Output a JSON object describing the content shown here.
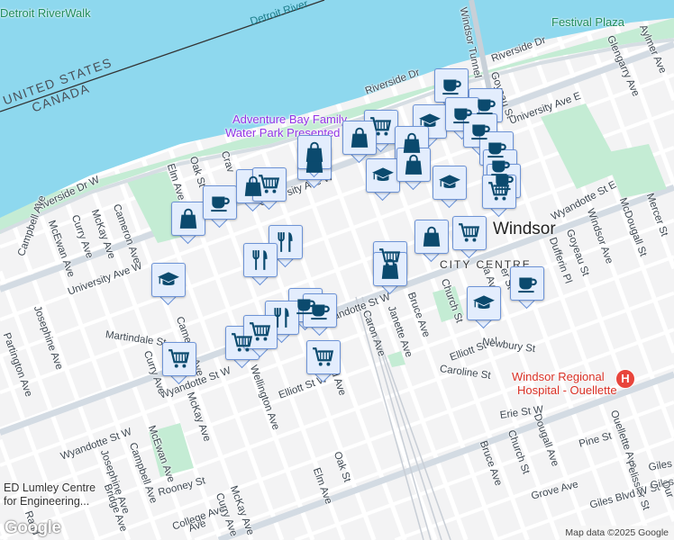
{
  "map": {
    "colors": {
      "water": "#8ed8ee",
      "land": "#f3f3f4",
      "park": "#c4ecd4",
      "marker_fill": "#e3edfd",
      "marker_border": "#6d93d6",
      "icon": "#0b4a6e",
      "hospital": "#e8453c"
    },
    "labels": [
      "Detroit RiverWalk",
      "Detroit River",
      "UNITED STATES",
      "CANADA",
      "Adventure Bay Family",
      "Water Park Presented",
      "Festival Plaza",
      "Windsor Tunnel",
      "Riverside Dr",
      "Riverside Dr",
      "Riverside Dr W",
      "Glengarry Ave",
      "Aylmer Ave",
      "Goyeau St",
      "University Ave E",
      "Oak St",
      "Elm Ave",
      "Crav",
      "University Ave W",
      "University Ave W",
      "Campbell Ave",
      "McEwan Ave",
      "Curry Ave",
      "McKay Ave",
      "Cameron Ave",
      "Windsor",
      "CITY CENTRE",
      "Wyandotte St E",
      "Mercer St",
      "McDougall St",
      "Windsor Ave",
      "Goyeau St",
      "Dufferin Pl",
      "Wyandotte St W",
      "Wyandotte St W",
      "Wyandotte St W",
      "Josephine Ave",
      "Partington Ave",
      "Martindale St",
      "Cameron Ave",
      "Curry Ave",
      "McKay Ave",
      "Wellington Ave",
      "Elliott St W",
      "d Ave",
      "Caron Ave",
      "Janette Ave",
      "Bruce Ave",
      "Church St",
      "Elliott St W",
      "Newbury St",
      "Caroline St",
      "Windsor Regional",
      "Hospital - Ouellette",
      "Erie St W",
      "Dougall Ave",
      "Church St",
      "Bruce Ave",
      "Pine St",
      "Ouellette Ave",
      "Pelissier St",
      "Giles",
      "Grove Ave",
      "Giles Blvd W St",
      "ED Lumley Centre",
      "for Engineering...",
      "Campbell Ave",
      "McEwan Ave",
      "Josephine Ave",
      "Rooney St",
      "Bridge Ave",
      "College Ave",
      "McKay Ave",
      "Curry Ave",
      "Elm Ave",
      "Oak St",
      "Rand",
      "Ave",
      "Giles",
      "Dur",
      "ia Ave",
      "er St"
    ],
    "markers": [
      "coffee",
      "coffee",
      "cart",
      "hat",
      "coffee",
      "coffee",
      "bag",
      "bag",
      "bag",
      "hat",
      "bag",
      "coffee",
      "coffee",
      "coffee",
      "hat",
      "cart",
      "bag",
      "coffee",
      "bag",
      "cart",
      "bag",
      "fork",
      "fork",
      "bag",
      "cart",
      "cart",
      "bag",
      "coffee",
      "hat",
      "hat",
      "cart",
      "cart",
      "cart",
      "coffee",
      "fork",
      "cart",
      "coffee"
    ],
    "hospital_glyph": "H",
    "logo": "Google",
    "attribution": "Map data ©2025 Google"
  }
}
